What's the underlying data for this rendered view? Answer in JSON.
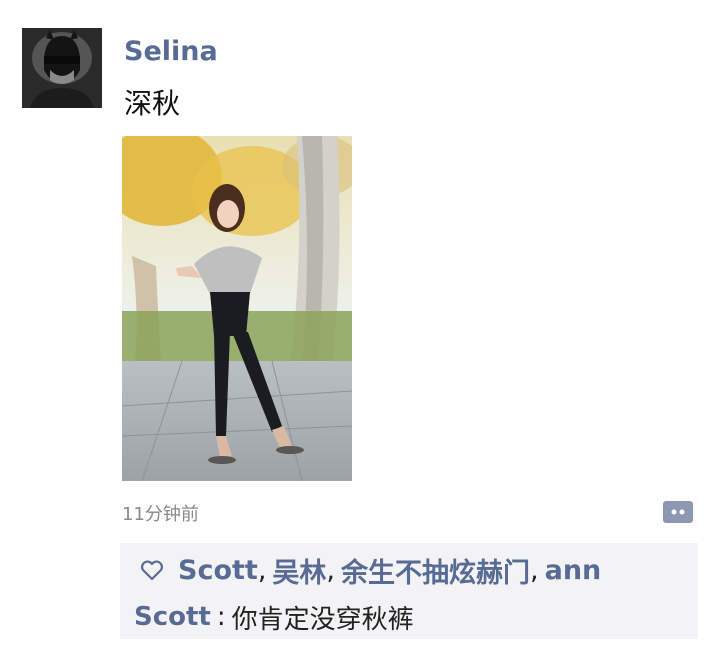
{
  "post": {
    "username": "Selina",
    "text": "深秋",
    "timestamp": "11分钟前"
  },
  "avatar": {
    "icon": "masked-person-avatar"
  },
  "photo": {
    "icon": "woman-standing-photo"
  },
  "likes": {
    "icon": "heart-outline-icon",
    "names": [
      "Scott",
      "吴林",
      "余生不抽炫赫门",
      "ann"
    ],
    "separator": ","
  },
  "comments": [
    {
      "author": "Scott",
      "separator": ":",
      "text": "你肯定没穿秋裤"
    }
  ],
  "colors": {
    "link": "#576b95",
    "panel_background": "#f3f3f5",
    "timestamp": "#8a8a8a"
  }
}
